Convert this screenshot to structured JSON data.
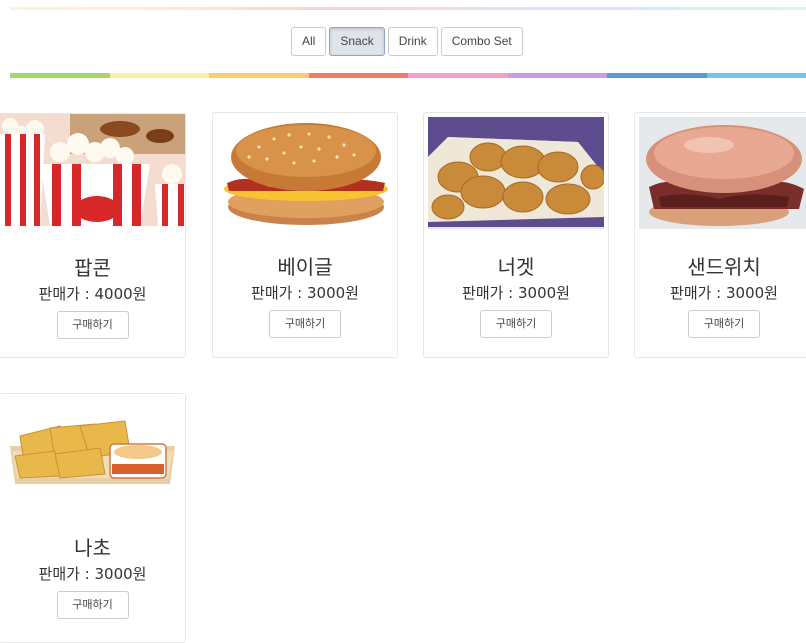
{
  "filters": [
    {
      "label": "All",
      "active": false
    },
    {
      "label": "Snack",
      "active": true
    },
    {
      "label": "Drink",
      "active": false
    },
    {
      "label": "Combo Set",
      "active": false
    }
  ],
  "rainbow_colors": [
    "#a6d66d",
    "#fbf0a3",
    "#fbcf6f",
    "#f07e6b",
    "#f2a0c8",
    "#c5a0dc",
    "#5b9bd5",
    "#76c5e8"
  ],
  "products": [
    {
      "name": "팝콘",
      "price": "판매가 : 4000원",
      "buy_label": "구매하기",
      "image": "popcorn"
    },
    {
      "name": "베이글",
      "price": "판매가 : 3000원",
      "buy_label": "구매하기",
      "image": "bagel-sandwich"
    },
    {
      "name": "너겟",
      "price": "판매가 : 3000원",
      "buy_label": "구매하기",
      "image": "chicken-nuggets"
    },
    {
      "name": "샌드위치",
      "price": "판매가 : 3000원",
      "buy_label": "구매하기",
      "image": "sandwich"
    },
    {
      "name": "나초",
      "price": "판매가 : 3000원",
      "buy_label": "구매하기",
      "image": "nachos"
    }
  ]
}
